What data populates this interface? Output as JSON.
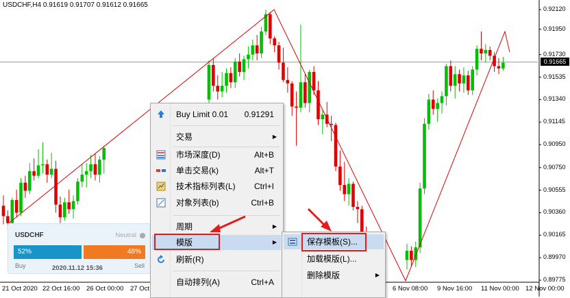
{
  "header": {
    "title": "USDCHF,H4  0.91619 0.91707 0.91612 0.91665"
  },
  "colors": {
    "bull": "#00c000",
    "bear": "#e00000",
    "trendline": "#e00000",
    "buy_bar": "#1a93c7",
    "sell_bar": "#f07a22",
    "highlight": "#e21b1b"
  },
  "chart_data": {
    "type": "candlestick",
    "symbol": "USDCHF",
    "timeframe": "H4",
    "ohlc_header": {
      "open": 0.91619,
      "high": 0.91707,
      "low": 0.91612,
      "close": 0.91665
    },
    "current_price": "0.91665",
    "ylim": [
      0.89775,
      0.9212
    ],
    "price_ticks": [
      "0.92120",
      "0.91950",
      "0.91730",
      "0.91535",
      "0.91340",
      "0.91145",
      "0.90950",
      "0.90750",
      "0.90555",
      "0.90360",
      "0.90165",
      "0.89970",
      "0.89775"
    ],
    "time_ticks": [
      "21 Oct 2020",
      "22 Oct 16:00",
      "26 Oct 00:00",
      "27 Oct",
      "6 Nov 08:00",
      "9 Nov 16:00",
      "11 Nov 00:00",
      "12 Nov 00:00"
    ],
    "candles_left": [
      [
        0.9042,
        0.9051,
        0.9026,
        0.9033
      ],
      [
        0.9033,
        0.9038,
        0.9021,
        0.9027
      ],
      [
        0.9027,
        0.9049,
        0.9024,
        0.9047
      ],
      [
        0.9047,
        0.9056,
        0.9032,
        0.9036
      ],
      [
        0.9036,
        0.9066,
        0.9033,
        0.9062
      ],
      [
        0.9062,
        0.9068,
        0.9049,
        0.9055
      ],
      [
        0.9055,
        0.9079,
        0.9052,
        0.9072
      ],
      [
        0.9072,
        0.9083,
        0.9064,
        0.9068
      ],
      [
        0.9068,
        0.9091,
        0.9066,
        0.9077
      ],
      [
        0.9077,
        0.9097,
        0.907,
        0.9078
      ],
      [
        0.9078,
        0.9082,
        0.9062,
        0.9069
      ],
      [
        0.9069,
        0.9088,
        0.9066,
        0.9074
      ],
      [
        0.9074,
        0.9081,
        0.9036,
        0.9043
      ],
      [
        0.9043,
        0.905,
        0.9027,
        0.9032
      ],
      [
        0.9032,
        0.9049,
        0.9029,
        0.9045
      ],
      [
        0.9045,
        0.9056,
        0.9035,
        0.9039
      ],
      [
        0.9039,
        0.9051,
        0.9031,
        0.9046
      ],
      [
        0.9046,
        0.9066,
        0.9043,
        0.9063
      ],
      [
        0.9063,
        0.9078,
        0.9058,
        0.9069
      ],
      [
        0.9069,
        0.9079,
        0.9058,
        0.9072
      ],
      [
        0.9072,
        0.9086,
        0.9066,
        0.9078
      ],
      [
        0.9078,
        0.9087,
        0.9064,
        0.9069
      ],
      [
        0.9069,
        0.9085,
        0.9062,
        0.9082
      ],
      [
        0.9082,
        0.9094,
        0.907,
        0.9092
      ]
    ],
    "candles_mid": [
      [
        0.9134,
        0.9168,
        0.9128,
        0.9164
      ],
      [
        0.9164,
        0.917,
        0.9141,
        0.9146
      ],
      [
        0.9146,
        0.9155,
        0.9134,
        0.9141
      ],
      [
        0.9141,
        0.9158,
        0.9136,
        0.9146
      ],
      [
        0.9146,
        0.9161,
        0.914,
        0.9157
      ],
      [
        0.9157,
        0.9162,
        0.9144,
        0.9149
      ],
      [
        0.9149,
        0.917,
        0.9144,
        0.9167
      ],
      [
        0.9167,
        0.9174,
        0.9154,
        0.9158
      ],
      [
        0.9158,
        0.9172,
        0.9151,
        0.9169
      ],
      [
        0.9169,
        0.918,
        0.9161,
        0.9173
      ],
      [
        0.9173,
        0.9186,
        0.9168,
        0.9181
      ],
      [
        0.9181,
        0.919,
        0.9168,
        0.9174
      ],
      [
        0.9174,
        0.9197,
        0.917,
        0.9193
      ],
      [
        0.9193,
        0.9212,
        0.919,
        0.9208
      ],
      [
        0.9208,
        0.921,
        0.9182,
        0.9187
      ],
      [
        0.9187,
        0.9189,
        0.9175,
        0.9181
      ],
      [
        0.9181,
        0.9184,
        0.916,
        0.9166
      ],
      [
        0.9166,
        0.9179,
        0.9149,
        0.9151
      ],
      [
        0.9151,
        0.9162,
        0.914,
        0.9148
      ],
      [
        0.9148,
        0.915,
        0.912,
        0.9128
      ],
      [
        0.9128,
        0.9141,
        0.9094,
        0.9127
      ],
      [
        0.9127,
        0.9199,
        0.9123,
        0.9149
      ],
      [
        0.9149,
        0.9156,
        0.9127,
        0.9131
      ],
      [
        0.9131,
        0.916,
        0.9123,
        0.9158
      ],
      [
        0.9158,
        0.9163,
        0.9138,
        0.9142
      ],
      [
        0.9142,
        0.915,
        0.9112,
        0.9117
      ],
      [
        0.9117,
        0.9125,
        0.9104,
        0.9121
      ],
      [
        0.9121,
        0.9132,
        0.911,
        0.9113
      ],
      [
        0.9113,
        0.912,
        0.9098,
        0.9112
      ],
      [
        0.9112,
        0.9114,
        0.9072,
        0.9076
      ],
      [
        0.9076,
        0.909,
        0.9055,
        0.906
      ],
      [
        0.906,
        0.908,
        0.9046,
        0.9052
      ],
      [
        0.9052,
        0.9066,
        0.9042,
        0.9061
      ],
      [
        0.9061,
        0.9063,
        0.9038,
        0.9041
      ],
      [
        0.9041,
        0.9046,
        0.9027,
        0.9039
      ],
      [
        0.9039,
        0.9042,
        0.9006,
        0.9012
      ],
      [
        0.9012,
        0.9024,
        0.8995,
        0.9001
      ],
      [
        0.9001,
        0.9006,
        0.8983,
        0.8987
      ],
      [
        0.8987,
        0.9,
        0.8977,
        0.8995
      ]
    ],
    "candles_right": [
      [
        0.8995,
        0.9009,
        0.8987,
        0.9003
      ],
      [
        0.9003,
        0.9007,
        0.899,
        0.8995
      ],
      [
        0.8995,
        0.9011,
        0.8989,
        0.9006
      ],
      [
        0.9006,
        0.9062,
        0.9001,
        0.9057
      ],
      [
        0.9057,
        0.9118,
        0.9052,
        0.9113
      ],
      [
        0.9113,
        0.9139,
        0.9108,
        0.9134
      ],
      [
        0.9134,
        0.9142,
        0.9121,
        0.9126
      ],
      [
        0.9126,
        0.9135,
        0.9115,
        0.9131
      ],
      [
        0.9131,
        0.9141,
        0.9122,
        0.9137
      ],
      [
        0.9137,
        0.9165,
        0.9129,
        0.9163
      ],
      [
        0.9163,
        0.9168,
        0.9141,
        0.9146
      ],
      [
        0.9146,
        0.9163,
        0.9135,
        0.9156
      ],
      [
        0.9156,
        0.916,
        0.9141,
        0.9148
      ],
      [
        0.9148,
        0.9162,
        0.914,
        0.9155
      ],
      [
        0.9155,
        0.9159,
        0.9138,
        0.9142
      ],
      [
        0.9142,
        0.9163,
        0.9138,
        0.916
      ],
      [
        0.916,
        0.9181,
        0.9155,
        0.9178
      ],
      [
        0.9178,
        0.9193,
        0.9168,
        0.9174
      ],
      [
        0.9174,
        0.9182,
        0.9166,
        0.9177
      ],
      [
        0.9177,
        0.918,
        0.9168,
        0.9172
      ],
      [
        0.9172,
        0.9175,
        0.9158,
        0.9163
      ],
      [
        0.9163,
        0.917,
        0.9156,
        0.9161
      ],
      [
        0.9161,
        0.9171,
        0.9159,
        0.9166
      ]
    ]
  },
  "trade_panel": {
    "symbol": "USDCHF",
    "status": "Neutral",
    "buy_percent": "52%",
    "sell_percent": "48%",
    "buy_label": "Buy",
    "sell_label": "Sell",
    "datetime": "2020.11.12 15:36"
  },
  "context_menu": {
    "items": [
      {
        "label": "Buy Limit 0.01",
        "shortcut": "0.91291",
        "icon": "buy-limit-icon"
      },
      {
        "label": "交易",
        "arrow": "▶"
      },
      {
        "label": "市场深度(D)",
        "shortcut": "Alt+B",
        "icon": "market-depth-icon"
      },
      {
        "label": "单击交易(k)",
        "shortcut": "Alt+T",
        "icon": "one-click-trade-icon"
      },
      {
        "label": "技术指标列表(L)",
        "shortcut": "Ctrl+I",
        "icon": "indicators-list-icon"
      },
      {
        "label": "对象列表(b)",
        "shortcut": "Ctrl+B",
        "icon": "objects-list-icon"
      },
      {
        "label": "周期",
        "arrow": "▶"
      },
      {
        "label": "模版",
        "arrow": "▶"
      },
      {
        "label": "刷新(R)",
        "icon": "refresh-icon"
      },
      {
        "label": "自动排列(A)",
        "shortcut": "Ctrl+A"
      }
    ]
  },
  "submenu": {
    "items": [
      {
        "label": "保存模板(S)...",
        "icon": "save-template-icon"
      },
      {
        "label": "加载模版(L)..."
      },
      {
        "label": "删除模版",
        "arrow": "▶"
      }
    ]
  }
}
